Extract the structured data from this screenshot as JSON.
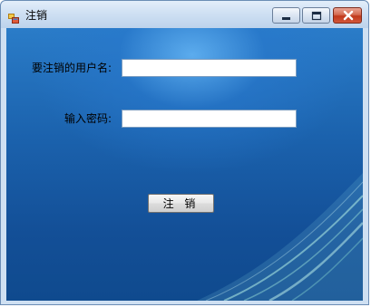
{
  "window": {
    "title": "注销",
    "app_icon": "form-app-icon"
  },
  "titlebar_buttons": {
    "minimize_icon": "minimize-icon",
    "maximize_icon": "maximize-icon",
    "close_icon": "close-icon"
  },
  "form": {
    "username_label": "要注销的用户名:",
    "username_value": "",
    "password_label": "输入密码:",
    "password_value": "",
    "submit_label": "注 销"
  },
  "colors": {
    "client_background": "#1b62ad",
    "close_button": "#c0381b"
  }
}
